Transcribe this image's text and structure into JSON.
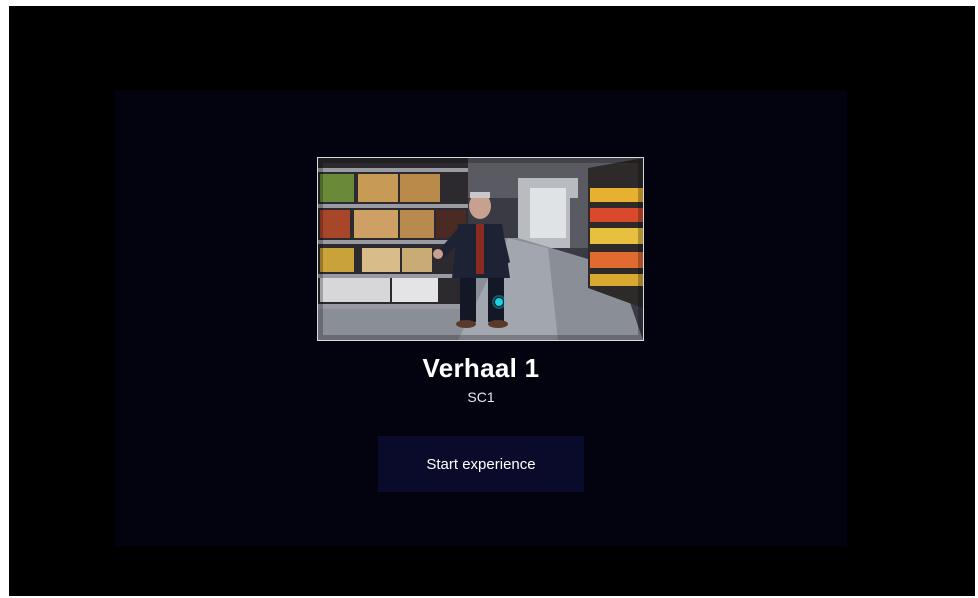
{
  "experience": {
    "title": "Verhaal 1",
    "subtitle": "SC1",
    "start_label": "Start experience",
    "thumbnail_icon": "supermarket-scene-image"
  },
  "colors": {
    "outer_background": "#000000",
    "panel_background": "#03030f",
    "button_background": "#0a0b2a",
    "text": "#ffffff",
    "hotspot": "#19d3e0"
  }
}
